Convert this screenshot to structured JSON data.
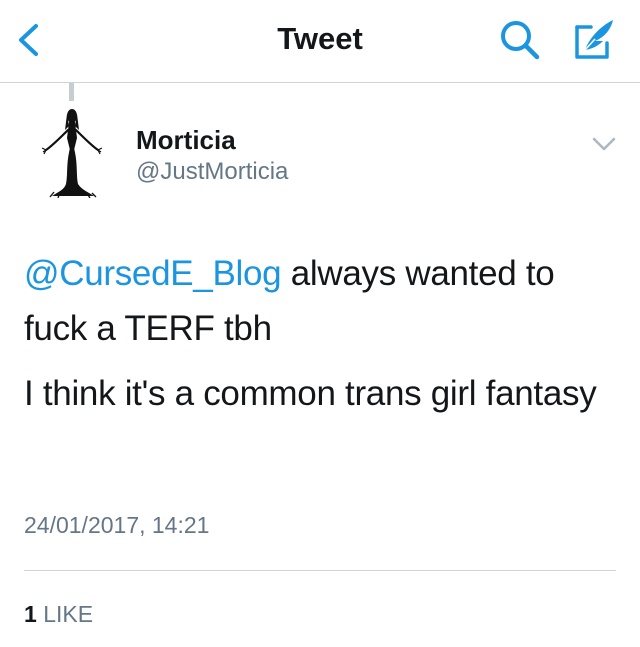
{
  "colors": {
    "accent": "#1b95e0",
    "secondary_text": "#657786",
    "primary_text": "#14171a",
    "divider": "#cfd4d8"
  },
  "navbar": {
    "back_icon": "chevron-left-icon",
    "title": "Tweet",
    "search_icon": "search-icon",
    "compose_icon": "compose-tweet-icon"
  },
  "tweet": {
    "author": {
      "name": "Morticia",
      "handle": "@JustMorticia",
      "avatar_icon": "morticia-silhouette-avatar"
    },
    "menu_icon": "chevron-down-icon",
    "paragraph1": {
      "mention": "@CursedE_Blog",
      "text": " always wanted to fuck a TERF tbh"
    },
    "paragraph2": "I think it's a common trans girl fantasy",
    "timestamp": "24/01/2017, 14:21",
    "likes": {
      "count": "1",
      "label": "LIKE"
    }
  }
}
